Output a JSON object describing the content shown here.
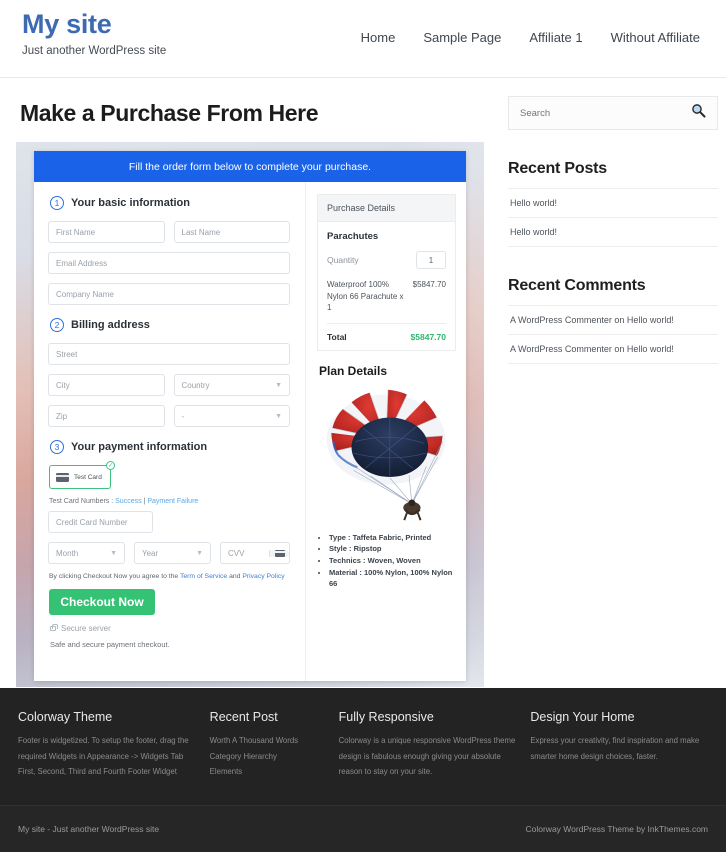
{
  "header": {
    "site_title": "My site",
    "tagline": "Just another WordPress site",
    "nav": [
      {
        "label": "Home"
      },
      {
        "label": "Sample Page"
      },
      {
        "label": "Affiliate 1"
      },
      {
        "label": "Without Affiliate"
      }
    ]
  },
  "page": {
    "title": "Make a Purchase From Here"
  },
  "order_form": {
    "banner": "Fill the order form below to complete your purchase.",
    "steps": [
      {
        "num": "1",
        "label": "Your basic information"
      },
      {
        "num": "2",
        "label": "Billing address"
      },
      {
        "num": "3",
        "label": "Your payment information"
      }
    ],
    "fields": {
      "first_name": "First Name",
      "last_name": "Last Name",
      "email": "Email Address",
      "company": "Company Name",
      "street": "Street",
      "city": "City",
      "country": "Country",
      "zip": "Zip",
      "state": "-",
      "credit_card": "Credit Card Number",
      "month": "Month",
      "year": "Year",
      "cvv": "CVV"
    },
    "payment_method": {
      "label": "Test Card",
      "icon": "credit-card-icon",
      "selected_check": "✓"
    },
    "test_cards": {
      "prefix": "Test Card Numbers : ",
      "success": "Success",
      "separator": " | ",
      "failure": "Payment Failure"
    },
    "terms": {
      "before": "By clicking Checkout Now you agree to the ",
      "tos": "Term of Service",
      "and": " and ",
      "privacy": "Privacy Policy"
    },
    "checkout_label": "Checkout Now",
    "secure_server": "Secure server",
    "safe_note": "Safe and secure payment checkout.",
    "accent_blue": "#1a62e8",
    "accent_green": "#35c275"
  },
  "purchase_details": {
    "heading": "Purchase Details",
    "product": "Parachutes",
    "quantity_label": "Quantity",
    "quantity_value": "1",
    "line_item_name": "Waterproof 100% Nylon 66 Parachute x 1",
    "line_item_price": "$5847.70",
    "total_label": "Total",
    "total_value": "$5847.70",
    "total_color": "#2fb86c"
  },
  "plan_details": {
    "title": "Plan Details",
    "image_name": "parachute-illustration",
    "specs": [
      "Type : Taffeta Fabric, Printed",
      "Style : Ripstop",
      "Technics : Woven, Woven",
      "Material : 100% Nylon, 100% Nylon 66"
    ]
  },
  "sidebar": {
    "search_placeholder": "Search",
    "search_icon": "magnifier-icon",
    "widgets": [
      {
        "title": "Recent Posts",
        "items": [
          "Hello world!",
          "Hello world!"
        ]
      },
      {
        "title": "Recent Comments",
        "items": [
          "A WordPress Commenter on Hello world!",
          "A WordPress Commenter on Hello world!"
        ]
      }
    ]
  },
  "footer": {
    "columns": [
      {
        "title": "Colorway Theme",
        "text": "Footer is widgetized. To setup the footer, drag the required Widgets in Appearance -> Widgets Tab First, Second, Third and Fourth Footer Widget",
        "items": []
      },
      {
        "title": "Recent Post",
        "text": "",
        "items": [
          "Worth A Thousand Words",
          "Category Hierarchy",
          "Elements"
        ]
      },
      {
        "title": "Fully Responsive",
        "text": "Colorway is a unique responsive WordPress theme design is fabulous enough giving your absolute reason to stay on your site.",
        "items": []
      },
      {
        "title": "Design Your Home",
        "text": "Express your creativity, find inspiration and make smarter home design choices, faster.",
        "items": []
      }
    ],
    "copyright_left": "My site - Just another WordPress site",
    "copyright_right": "Colorway WordPress Theme by InkThemes.com"
  }
}
